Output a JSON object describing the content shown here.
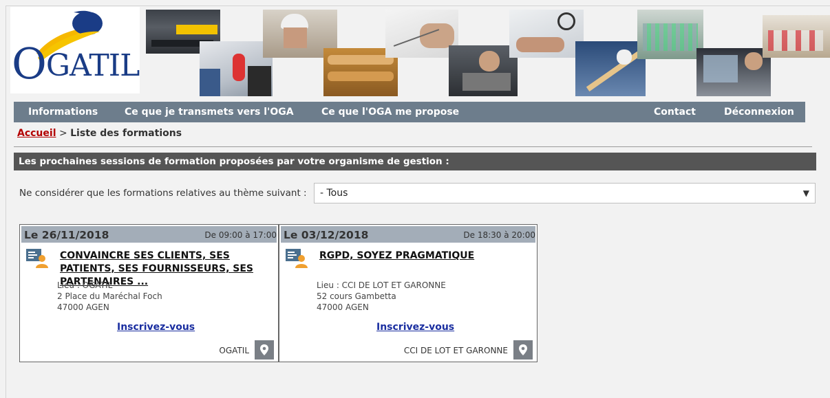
{
  "logo": {
    "text": "GATIL",
    "initial": "O"
  },
  "nav": {
    "items": [
      {
        "label": "Informations"
      },
      {
        "label": "Ce que je transmets vers l'OGA"
      },
      {
        "label": "Ce que l'OGA me propose"
      },
      {
        "label": "Contact"
      },
      {
        "label": "Déconnexion"
      }
    ]
  },
  "breadcrumb": {
    "home": "Accueil",
    "separator": ">",
    "current": "Liste des formations"
  },
  "section_title": "Les prochaines sessions de formation proposées par votre organisme de gestion :",
  "filter": {
    "label": "Ne considérer que les formations relatives au thème suivant :",
    "selected": "- Tous"
  },
  "sessions": [
    {
      "date": "Le 26/11/2018",
      "time": "De 09:00 à 17:00",
      "title_lines": [
        "CONVAINCRE SES CLIENTS, SES",
        "PATIENTS, SES FOURNISSEURS, SES",
        "PARTENAIRES ..."
      ],
      "address": [
        "Lieu : OGATIL",
        "2 Place du Maréchal Foch",
        "47000 AGEN"
      ],
      "signup": "Inscrivez-vous",
      "org": "OGATIL"
    },
    {
      "date": "Le 03/12/2018",
      "time": "De 18:30 à 20:00",
      "title_lines": [
        "RGPD, SOYEZ PRAGMATIQUE"
      ],
      "address": [
        "Lieu : CCI DE LOT ET GARONNE",
        "52 cours Gambetta",
        "47000 AGEN"
      ],
      "signup": "Inscrivez-vous",
      "org": "CCI DE LOT ET GARONNE"
    }
  ],
  "colors": {
    "nav_bg": "#6d7d8c",
    "section_bg": "#555555",
    "card_head_bg": "#a3adb8",
    "link_red": "#b30000",
    "link_blue": "#1a2ea0",
    "icon_orange": "#f0a030"
  }
}
